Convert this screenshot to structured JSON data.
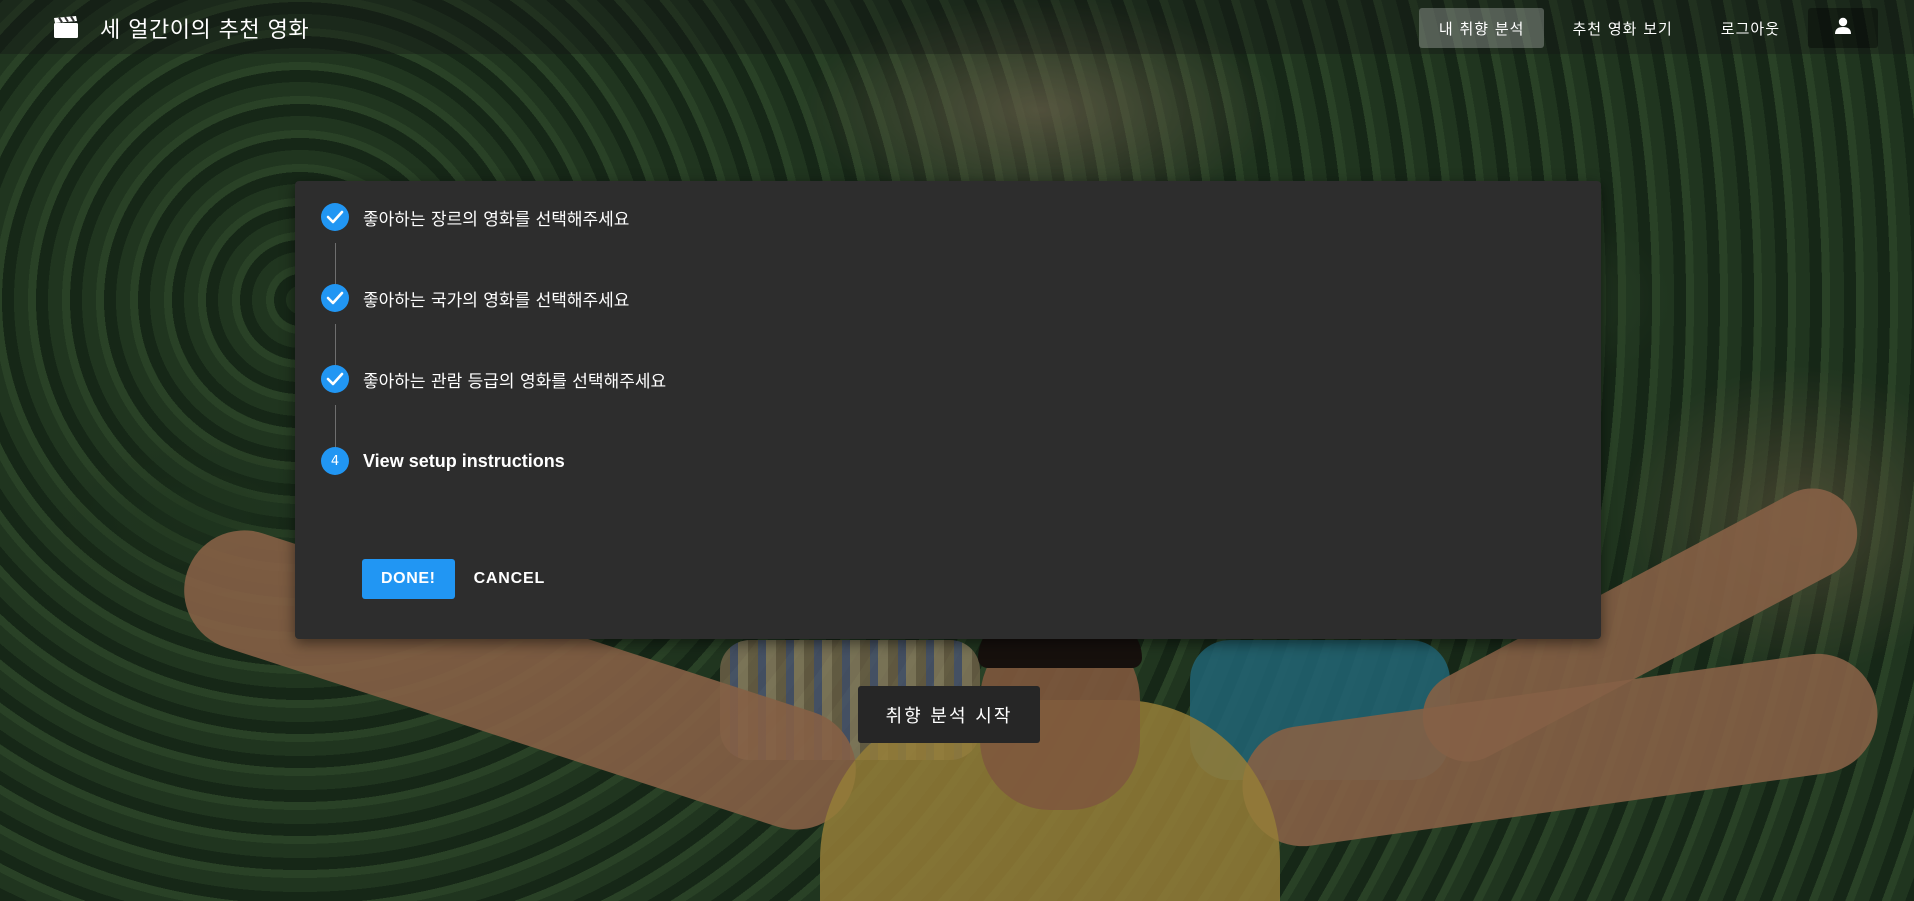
{
  "app": {
    "title": "세 얼간이의 추천 영화",
    "logo_icon": "clapperboard-icon"
  },
  "nav": {
    "items": [
      {
        "label": "내 취향 분석",
        "active": true
      },
      {
        "label": "추천 영화 보기",
        "active": false
      },
      {
        "label": "로그아웃",
        "active": false
      }
    ],
    "user_icon": "user-icon"
  },
  "stepper": {
    "steps": [
      {
        "label": "좋아하는 장르의 영화를 선택해주세요",
        "state": "completed",
        "icon": "check-icon"
      },
      {
        "label": "좋아하는 국가의 영화를 선택해주세요",
        "state": "completed",
        "icon": "check-icon"
      },
      {
        "label": "좋아하는 관람 등급의 영화를 선택해주세요",
        "state": "completed",
        "icon": "check-icon"
      },
      {
        "label": "View setup instructions",
        "state": "active",
        "number": "4"
      }
    ],
    "done_label": "DONE!",
    "cancel_label": "CANCEL"
  },
  "start_button_label": "취향 분석 시작",
  "colors": {
    "accent": "#2196f3",
    "card_background": "#2d2d2d",
    "start_button_background": "#262626"
  }
}
